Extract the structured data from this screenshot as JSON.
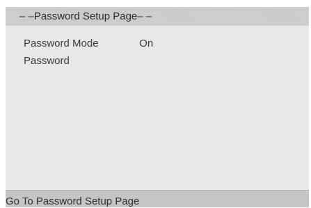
{
  "header": {
    "title": "– –Password Setup Page– –"
  },
  "settings": {
    "items": [
      {
        "label": "Password Mode",
        "value": "On"
      },
      {
        "label": "Password",
        "value": ""
      }
    ]
  },
  "status_bar": {
    "text": "Go To Password Setup Page"
  },
  "colors": {
    "header_bg": "#c9c9c9",
    "body_bg": "#e8e8e8",
    "status_bg": "#c5c5c5",
    "text": "#3a3a3a"
  }
}
